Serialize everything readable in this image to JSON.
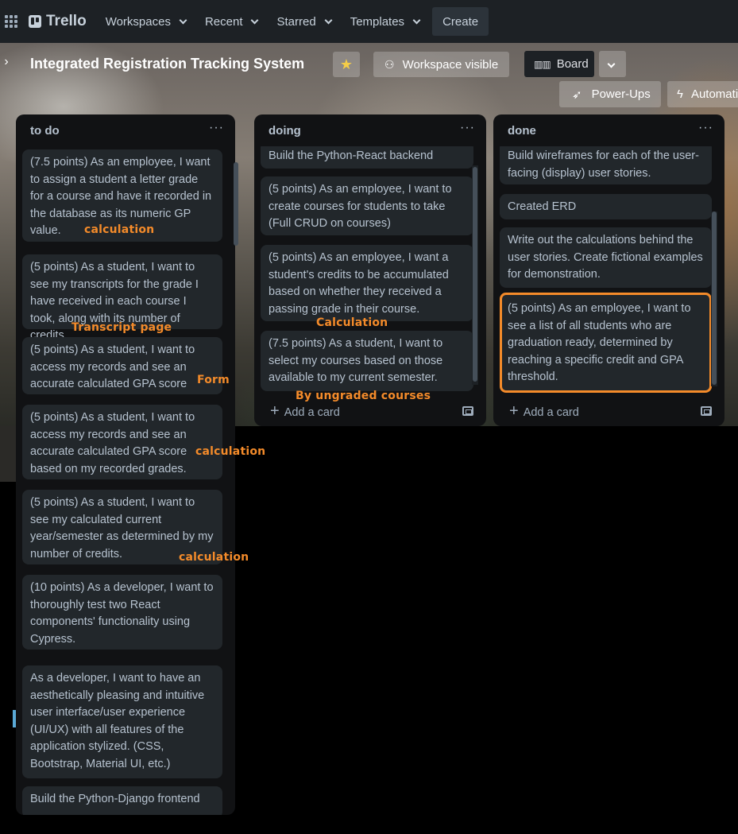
{
  "nav": {
    "logo": "Trello",
    "items": [
      "Workspaces",
      "Recent",
      "Starred",
      "Templates"
    ],
    "create": "Create"
  },
  "board": {
    "title": "Integrated Registration Tracking System",
    "visibility": "Workspace visible",
    "view": "Board",
    "powerups": "Power-Ups",
    "automation": "Automation"
  },
  "lists": [
    {
      "title": "to do",
      "cards": [
        "(7.5 points) As an employee, I want to assign a student a letter grade for a course and have it recorded in the database as its numeric GP value.",
        "(5 points) As a student, I want to see my transcripts for the grade I have received in each course I took, along with its number of credits.",
        "(5 points) As a student, I want to access my records and see an accurate calculated GPA score",
        "(5 points) As a student, I want to access my records and see an accurate calculated GPA score based on my recorded grades.",
        "(5 points) As a student, I want to see my calculated current year/semester as determined by my number of credits.",
        "(10 points) As a developer, I want to thoroughly test two React components' functionality using Cypress.",
        "As a developer, I want to have an aesthetically pleasing and intuitive user interface/user experience (UI/UX) with all features of the application stylized. (CSS, Bootstrap, Material UI, etc.)",
        "Build the Python-Django frontend"
      ]
    },
    {
      "title": "doing",
      "cards": [
        "Build the Python-React backend",
        "(5 points) As an employee, I want to create courses for students to take (Full CRUD on courses)",
        "(5 points) As an employee, I want a student's credits to be accumulated based on whether they received a passing grade in their course.",
        "(7.5 points) As a student, I want to select my courses based on those available to my current semester."
      ],
      "add": "Add a card"
    },
    {
      "title": "done",
      "cards": [
        "Build wireframes for each of the user-facing (display) user stories.",
        "Created ERD",
        "Write out the calculations behind the user stories. Create fictional examples for demonstration.",
        "(5 points) As an employee, I want to see a list of all students who are graduation ready, determined by reaching a specific credit and GPA threshold."
      ],
      "add": "Add a card"
    }
  ],
  "annotations": {
    "a1": "calculation",
    "a2": "Transcript page",
    "a3": "Form",
    "a4": "calculation",
    "a5": "calculation",
    "a6": "Calculation",
    "a7": "By ungraded courses"
  },
  "colors": {
    "annotation": "#f48b2a",
    "highlight": "#f48b2a",
    "star": "#f5cd47"
  }
}
